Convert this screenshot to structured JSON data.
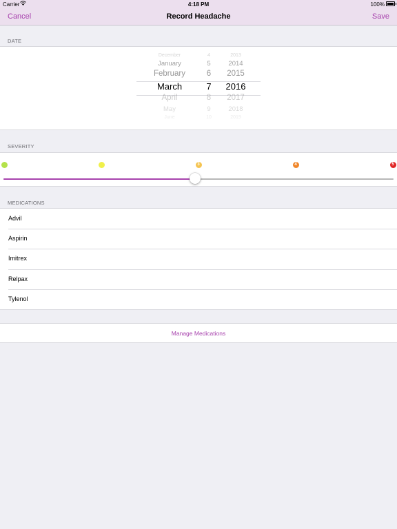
{
  "status_bar": {
    "carrier": "Carrier",
    "time": "4:18 PM",
    "battery": "100%"
  },
  "nav": {
    "cancel_label": "Cancel",
    "title": "Record Headache",
    "save_label": "Save",
    "accent_color": "#a742ad"
  },
  "date_section": {
    "header": "DATE",
    "picker_rows": [
      {
        "month": "December",
        "day": "4",
        "year": "2013"
      },
      {
        "month": "January",
        "day": "5",
        "year": "2014"
      },
      {
        "month": "February",
        "day": "6",
        "year": "2015"
      },
      {
        "month": "March",
        "day": "7",
        "year": "2016"
      },
      {
        "month": "April",
        "day": "8",
        "year": "2017"
      },
      {
        "month": "May",
        "day": "9",
        "year": "2018"
      },
      {
        "month": "June",
        "day": "10",
        "year": "2019"
      }
    ],
    "selected": {
      "month": "March",
      "day": "7",
      "year": "2016"
    }
  },
  "severity_section": {
    "header": "SEVERITY",
    "levels": [
      {
        "label": "1",
        "color": "#b4e24b"
      },
      {
        "label": "2",
        "color": "#f0f04b"
      },
      {
        "label": "3",
        "color": "#f5c451"
      },
      {
        "label": "4",
        "color": "#f0862a"
      },
      {
        "label": "5",
        "color": "#e02424"
      }
    ],
    "slider_value": 3,
    "slider_min": 1,
    "slider_max": 5
  },
  "medications_section": {
    "header": "MEDICATIONS",
    "items": [
      "Advil",
      "Aspirin",
      "Imitrex",
      "Relpax",
      "Tylenol"
    ]
  },
  "manage_label": "Manage Medications"
}
